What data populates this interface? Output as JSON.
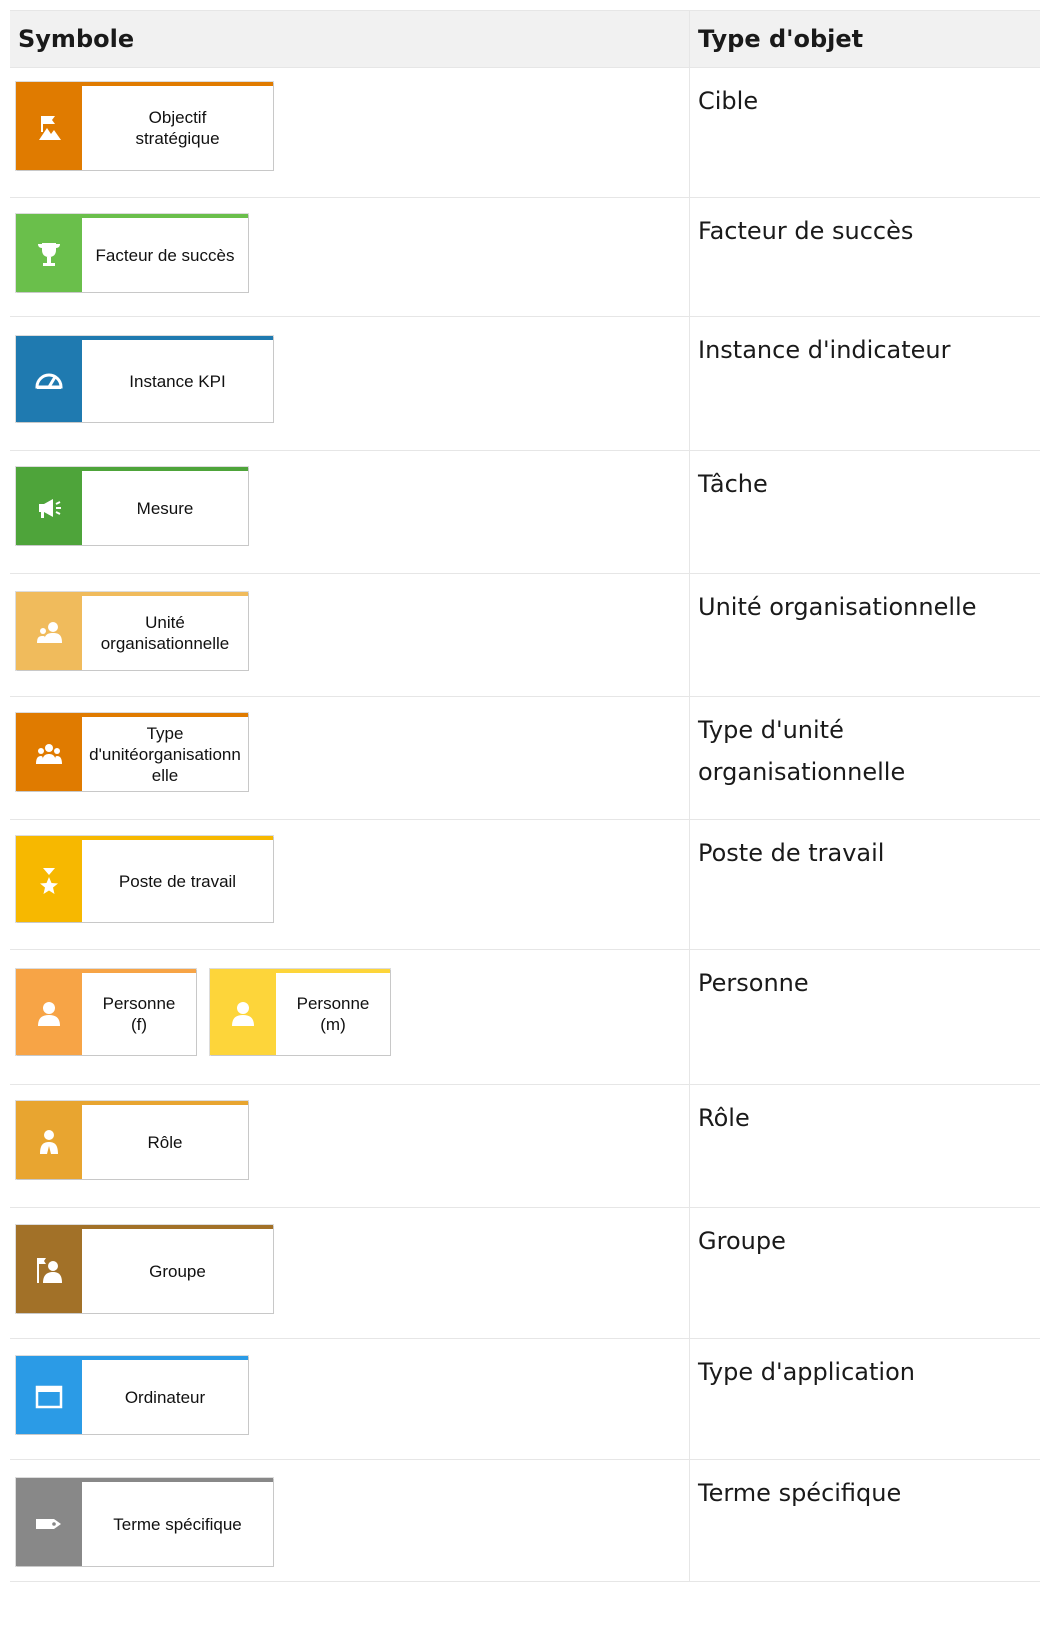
{
  "header": {
    "col1": "Symbole",
    "col2": "Type d'objet"
  },
  "rows": [
    {
      "type": "Cible",
      "symbols": [
        {
          "label": "Objectif\nstratégique",
          "color": "#e07b00",
          "icon": "flag-mountain-icon"
        }
      ]
    },
    {
      "type": "Facteur de succès",
      "symbols": [
        {
          "label": "Facteur de succès",
          "color": "#6abf4b",
          "icon": "trophy-icon"
        }
      ]
    },
    {
      "type": "Instance d'indicateur",
      "symbols": [
        {
          "label": "Instance KPI",
          "color": "#1f7ab0",
          "icon": "gauge-icon"
        }
      ]
    },
    {
      "type": "Tâche",
      "symbols": [
        {
          "label": "Mesure",
          "color": "#4ea43a",
          "icon": "megaphone-icon"
        }
      ]
    },
    {
      "type": "Unité organisationnelle",
      "symbols": [
        {
          "label": "Unité\norganisationnelle",
          "color": "#f0bb5c",
          "icon": "org-unit-icon"
        }
      ]
    },
    {
      "type": "Type d'unité\norganisationnelle",
      "symbols": [
        {
          "label": "Type\nd'unitéorganisationn\nelle",
          "color": "#e07b00",
          "icon": "group-people-icon"
        }
      ]
    },
    {
      "type": "Poste de travail",
      "symbols": [
        {
          "label": "Poste de travail",
          "color": "#f7b800",
          "icon": "star-position-icon"
        }
      ]
    },
    {
      "type": "Personne",
      "symbols": [
        {
          "label": "Personne\n(f)",
          "color": "#f7a446",
          "icon": "person-icon"
        },
        {
          "label": "Personne\n(m)",
          "color": "#fdd53a",
          "icon": "person-icon"
        }
      ]
    },
    {
      "type": "Rôle",
      "symbols": [
        {
          "label": "Rôle",
          "color": "#e8a530",
          "icon": "role-person-icon"
        }
      ]
    },
    {
      "type": "Groupe",
      "symbols": [
        {
          "label": "Groupe",
          "color": "#a27128",
          "icon": "group-flag-icon"
        }
      ]
    },
    {
      "type": "Type d'application",
      "symbols": [
        {
          "label": "Ordinateur",
          "color": "#2b9be6",
          "icon": "window-icon"
        }
      ]
    },
    {
      "type": "Terme spécifique",
      "symbols": [
        {
          "label": "Terme spécifique",
          "color": "#888888",
          "icon": "tag-icon"
        }
      ]
    }
  ]
}
